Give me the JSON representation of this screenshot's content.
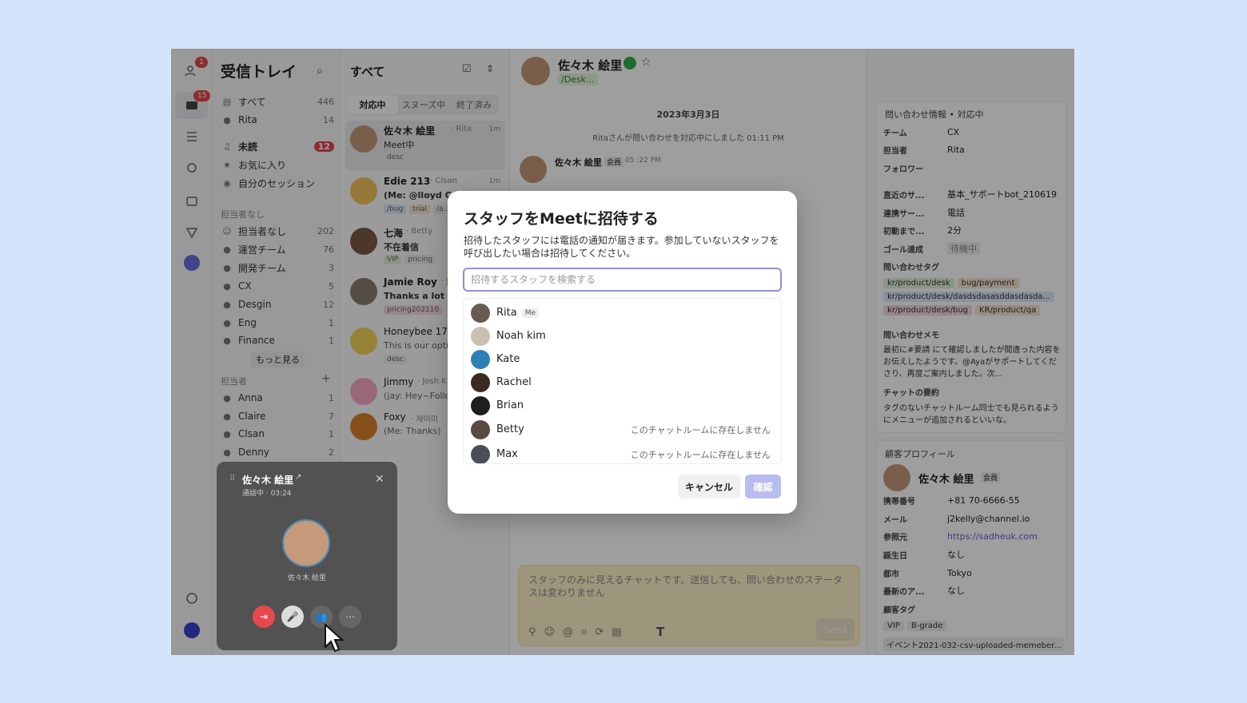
{
  "rail": {
    "contacts_badge": "1",
    "inbox_badge": "15"
  },
  "inbox": {
    "title": "受信トレイ",
    "all_label": "すべて",
    "all_count": "446",
    "rita_label": "Rita",
    "rita_count": "14",
    "unread_label": "未読",
    "unread_count": "12",
    "favorites_label": "お気に入り",
    "my_sessions_label": "自分のセッション",
    "section_unassigned": "担当者なし",
    "teams": [
      {
        "label": "担当者なし",
        "count": "202"
      },
      {
        "label": "運営チーム",
        "count": "76"
      },
      {
        "label": "開発チーム",
        "count": "3"
      },
      {
        "label": "CX",
        "count": "5"
      },
      {
        "label": "Desgin",
        "count": "12"
      },
      {
        "label": "Eng",
        "count": "1"
      },
      {
        "label": "Finance",
        "count": "1"
      }
    ],
    "more_label": "もっと見る",
    "section_assignee": "担当者",
    "assignees": [
      {
        "label": "Anna",
        "count": "1"
      },
      {
        "label": "Claire",
        "count": "7"
      },
      {
        "label": "Clsan",
        "count": "1"
      },
      {
        "label": "Denny",
        "count": "2"
      }
    ]
  },
  "list": {
    "title": "すべて",
    "tabs": [
      "対応中",
      "スヌーズ中",
      "終了済み"
    ],
    "items": [
      {
        "name": "佐々木 絵里",
        "meta": "· Rita",
        "time": "1m",
        "sub": "Meet中",
        "tag": "desc"
      },
      {
        "name": "Edie 213",
        "meta": "· Clsan",
        "time": "1m",
        "sub": "(Me: @lloyd Can",
        "tag": "/bug"
      },
      {
        "name": "七海",
        "meta": "· Betty",
        "time": "",
        "sub": "不在着信",
        "tag": "VIP"
      },
      {
        "name": "Jamie Roy",
        "meta": "· Jo",
        "time": "",
        "sub": "Thanks a lot 😍",
        "tag": "pricing202110"
      },
      {
        "name": "Honeybee 178",
        "meta": "",
        "time": "",
        "sub": "This is our optio",
        "tag": "desc"
      },
      {
        "name": "Jimmy",
        "meta": "· Josh K",
        "time": "",
        "sub": "(jay: Hey~Follow",
        "tag": ""
      },
      {
        "name": "Foxy",
        "meta": "· 제이미",
        "time": "",
        "sub": "(Me: Thanks)",
        "tag": ""
      }
    ],
    "tags_extra": [
      "trial",
      "/a...",
      "pricing"
    ]
  },
  "chat": {
    "contact_name": "佐々木 絵里",
    "contact_sub": "/Desk...",
    "date": "2023年3月3日",
    "system_msg": "Ritaさんが問い合わせを対応中にしました",
    "system_time": "01:11 PM",
    "msg_name": "佐々木 絵里",
    "msg_badge": "会員",
    "msg_time": "05 :22 PM",
    "composer_placeholder": "スタッフのみに見えるチャットです。送信しても、問い合わせのステータスは変わりません",
    "send_label": "Send"
  },
  "right": {
    "header": "問い合わせ情報 • 対応中",
    "rows": [
      {
        "k": "チーム",
        "v": "CX"
      },
      {
        "k": "担当者",
        "v": "Rita"
      },
      {
        "k": "フォロワー",
        "v": ""
      },
      {
        "k": "直近のサ...",
        "v": "基本_サポートbot_210619"
      },
      {
        "k": "連携サー...",
        "v": "電話"
      },
      {
        "k": "初動まで...",
        "v": "2分"
      },
      {
        "k": "ゴール達成",
        "v": "待機中"
      },
      {
        "k": "問い合わせタグ",
        "v": ""
      }
    ],
    "tags": [
      "kr/product/desk",
      "bug/payment",
      "kr/product/desk/dasdsdasasddasdasda...",
      "kr/product/desk/bug",
      "KR/product/qa"
    ],
    "memo_label": "問い合わせメモ",
    "memo_text": "最初に#要請 にて確認しましたが間違った内容をお伝えしたようです。@Ayaがサポートしてくださり、再度ご案内しました。次...",
    "summary_label": "チャットの要約",
    "summary_text": "タグのないチャットルーム同士でも見られるようにメニューが追加されるといいな。",
    "profile_header": "顧客プロフィール",
    "profile_name": "佐々木 絵里",
    "profile_badge": "会員",
    "profile_rows": [
      {
        "k": "携帯番号",
        "v": "+81 70-6666-55"
      },
      {
        "k": "メール",
        "v": "j2kelly@channel.io"
      },
      {
        "k": "参照元",
        "v": "https://sadheuk.com"
      },
      {
        "k": "誕生日",
        "v": "なし"
      },
      {
        "k": "都市",
        "v": "Tokyo"
      },
      {
        "k": "最新のア...",
        "v": "なし"
      },
      {
        "k": "顧客タグ",
        "v": ""
      }
    ],
    "customer_tags": [
      "VIP",
      "B-grade"
    ],
    "event_text": "イベント2021-032-csv-uploaded-memeber..."
  },
  "call": {
    "name": "佐々木 絵里",
    "status": "通話中 · 03:24",
    "avatar_name": "佐々木 絵里"
  },
  "modal": {
    "title": "スタッフをMeetに招待する",
    "description": "招待したスタッフには電話の通知が届きます。参加していないスタッフを呼び出したい場合は招待してください。",
    "search_placeholder": "招待するスタッフを検索する",
    "staff": [
      {
        "name": "Rita",
        "me": "Me",
        "note": ""
      },
      {
        "name": "Noah kim",
        "me": "",
        "note": ""
      },
      {
        "name": "Kate",
        "me": "",
        "note": ""
      },
      {
        "name": "Rachel",
        "me": "",
        "note": ""
      },
      {
        "name": "Brian",
        "me": "",
        "note": ""
      },
      {
        "name": "Betty",
        "me": "",
        "note": "このチャットルームに存在しません"
      },
      {
        "name": "Max",
        "me": "",
        "note": "このチャットルームに存在しません"
      }
    ],
    "cancel_label": "キャンセル",
    "confirm_label": "確認"
  },
  "colors": {
    "accent": "#6b6fe0",
    "badge": "#e5484d",
    "green": "#31b14e",
    "backdrop": "#d6e4fb"
  }
}
